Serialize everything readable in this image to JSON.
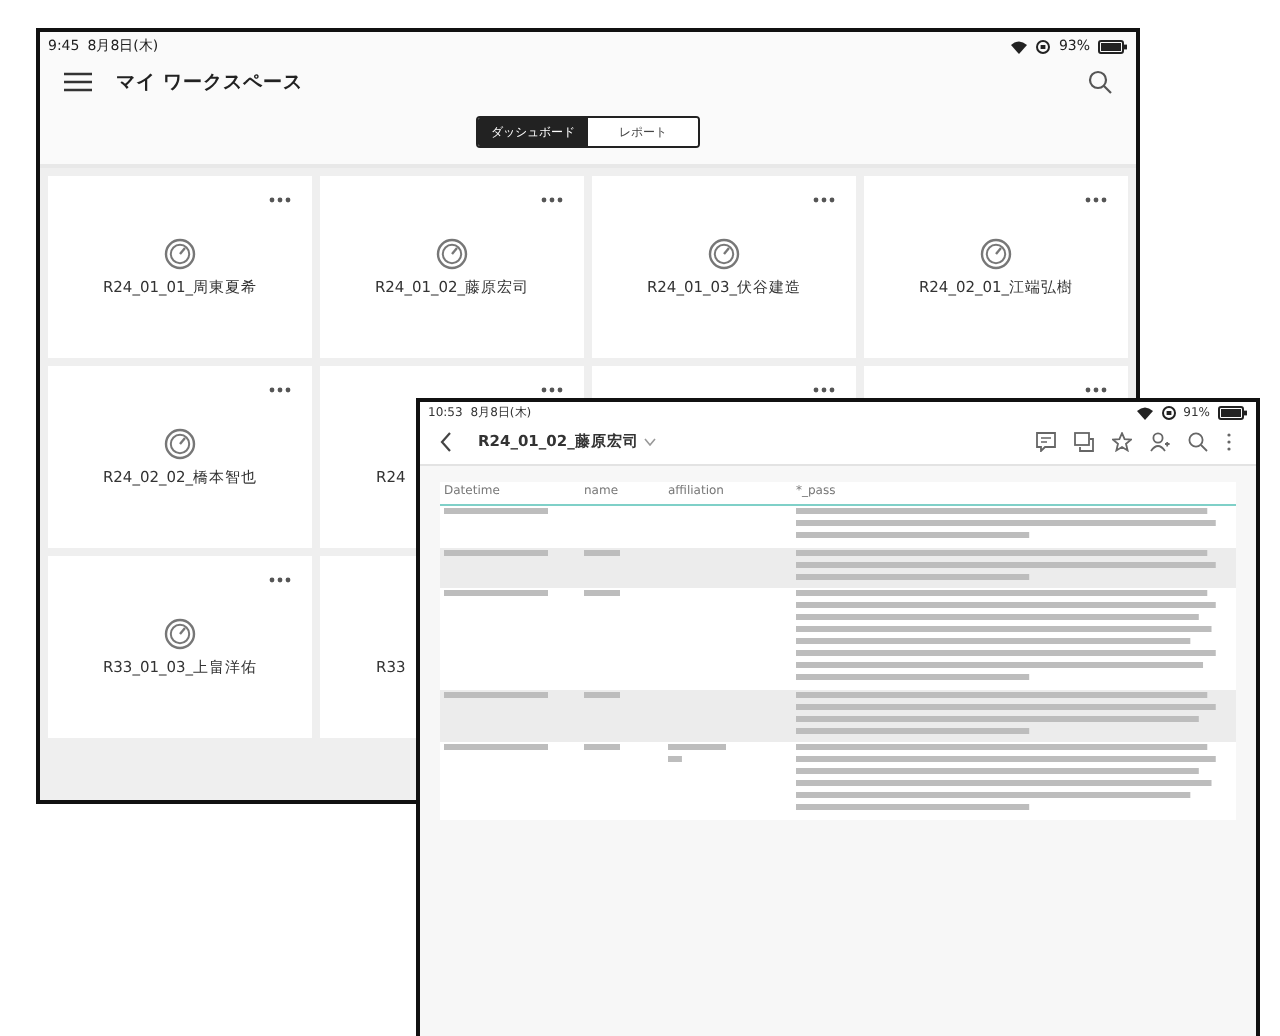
{
  "back_window": {
    "status_bar": {
      "time": "9:45",
      "date": "8月8日(木)",
      "battery": "93%"
    },
    "title": "マイ ワークスペース",
    "tabs": [
      {
        "label": "ダッシュボード",
        "selected": true
      },
      {
        "label": "レポート",
        "selected": false
      }
    ],
    "cards": [
      {
        "title": "R24_01_01_周東夏希",
        "kind": "full"
      },
      {
        "title": "R24_01_02_藤原宏司",
        "kind": "full"
      },
      {
        "title": "R24_01_03_伏谷建造",
        "kind": "full"
      },
      {
        "title": "R24_02_01_江端弘樹",
        "kind": "full"
      },
      {
        "title": "R24_02_02_橋本智也",
        "kind": "full"
      },
      {
        "title": "R24",
        "kind": "covered"
      },
      {
        "kind": "menu_only"
      },
      {
        "kind": "menu_only"
      },
      {
        "title": "R33_01_03_上畠洋佑",
        "kind": "full"
      },
      {
        "title": "R33",
        "kind": "covered"
      }
    ]
  },
  "front_window": {
    "status_bar": {
      "time": "10:53",
      "date": "8月8日(木)",
      "battery": "91%"
    },
    "title": "R24_01_02_藤原宏司",
    "table": {
      "columns": [
        "Datetime",
        "name",
        "affiliation",
        "*_pass"
      ]
    }
  }
}
